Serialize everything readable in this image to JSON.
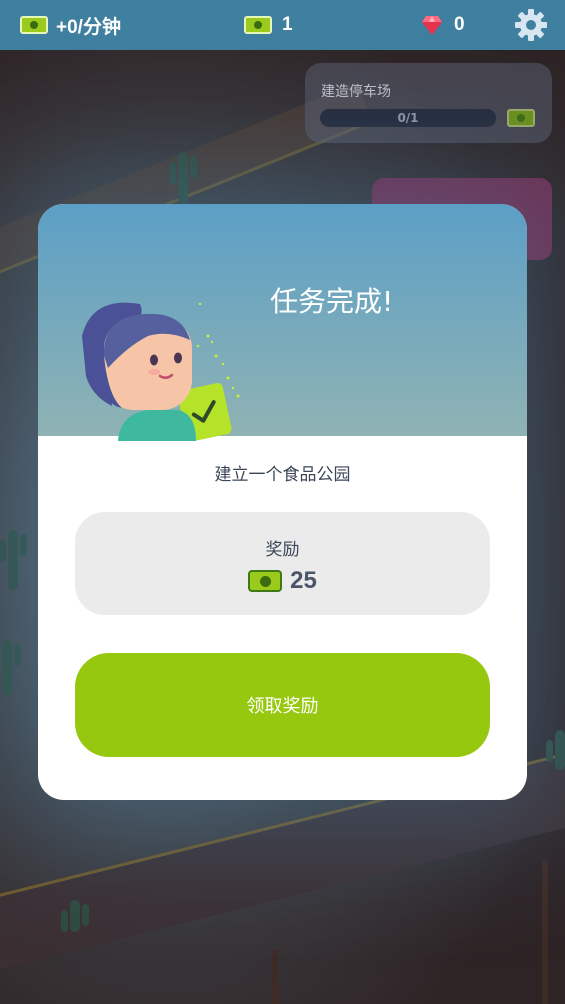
{
  "hud": {
    "income_label": "+0/分钟",
    "cash_count": "1",
    "gem_count": "0"
  },
  "quest": {
    "title": "建造停车场",
    "progress_label": "0/1",
    "progress_fraction": 0
  },
  "modal": {
    "title": "任务完成!",
    "task_description": "建立一个食品公园",
    "reward_label": "奖励",
    "reward_amount": "25",
    "claim_button_label": "领取奖励"
  },
  "colors": {
    "hud_bg": "#3f7f9f",
    "accent_green": "#96c80f",
    "reward_box_bg": "#ebebeb"
  },
  "icons": [
    "cash-icon",
    "gem-icon",
    "settings-gear-icon",
    "checkmark-icon"
  ]
}
